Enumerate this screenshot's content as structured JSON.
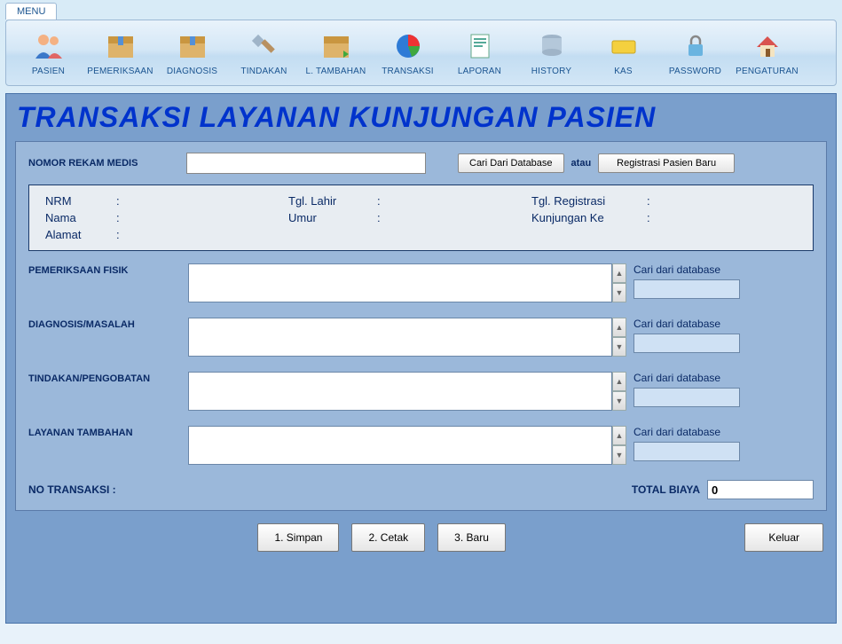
{
  "tab": {
    "label": "MENU"
  },
  "ribbon": [
    {
      "label": "PASIEN",
      "icon": "people"
    },
    {
      "label": "PEMERIKSAAN",
      "icon": "box"
    },
    {
      "label": "DIAGNOSIS",
      "icon": "box"
    },
    {
      "label": "TINDAKAN",
      "icon": "tool"
    },
    {
      "label": "L. TAMBAHAN",
      "icon": "box-arrow"
    },
    {
      "label": "TRANSAKSI",
      "icon": "pie"
    },
    {
      "label": "LAPORAN",
      "icon": "report"
    },
    {
      "label": "HISTORY",
      "icon": "db"
    },
    {
      "label": "KAS",
      "icon": "money"
    },
    {
      "label": "PASSWORD",
      "icon": "lock"
    },
    {
      "label": "PENGATURAN",
      "icon": "home"
    }
  ],
  "title": "TRANSAKSI LAYANAN KUNJUNGAN PASIEN",
  "search": {
    "label": "NOMOR REKAM MEDIS",
    "value": "",
    "btn_cari": "Cari Dari Database",
    "or": "atau",
    "btn_reg": "Registrasi Pasien Baru"
  },
  "info": {
    "nrm_k": "NRM",
    "nrm_v": "",
    "tgl_lahir_k": "Tgl. Lahir",
    "tgl_lahir_v": "",
    "tgl_reg_k": "Tgl. Registrasi",
    "tgl_reg_v": "",
    "nama_k": "Nama",
    "nama_v": "",
    "umur_k": "Umur",
    "umur_v": "",
    "kunj_k": "Kunjungan Ke",
    "kunj_v": "",
    "alamat_k": "Alamat",
    "alamat_v": ""
  },
  "entries": {
    "pf": {
      "label": "PEMERIKSAAN FISIK",
      "value": "",
      "link": "Cari dari database",
      "side_value": ""
    },
    "dx": {
      "label": "DIAGNOSIS/MASALAH",
      "value": "",
      "link": "Cari dari database",
      "side_value": ""
    },
    "tx": {
      "label": "TINDAKAN/PENGOBATAN",
      "value": "",
      "link": "Cari dari database",
      "side_value": ""
    },
    "lt": {
      "label": "LAYANAN TAMBAHAN",
      "value": "",
      "link": "Cari dari database",
      "side_value": ""
    }
  },
  "footer": {
    "notrans_label": "NO TRANSAKSI :",
    "notrans_value": "",
    "total_label": "TOTAL BIAYA",
    "total_value": "0"
  },
  "buttons": {
    "simpan": "1. Simpan",
    "cetak": "2. Cetak",
    "baru": "3. Baru",
    "keluar": "Keluar"
  },
  "colon": ":"
}
